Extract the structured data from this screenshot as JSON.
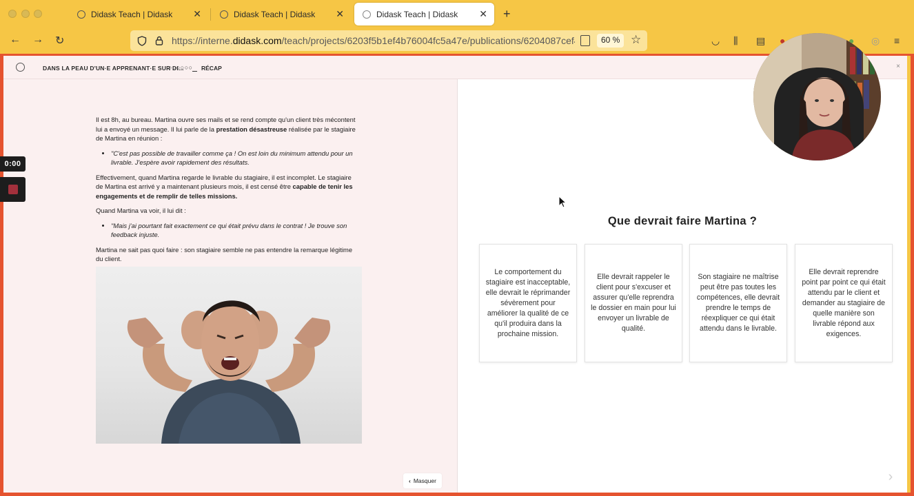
{
  "browser": {
    "tabs": [
      {
        "title": "Didask Teach | Didask",
        "close": "✕"
      },
      {
        "title": "Didask Teach | Didask",
        "close": "✕"
      },
      {
        "title": "Didask Teach | Didask",
        "close": "✕"
      }
    ],
    "new_tab": "+",
    "url_prefix": "https://interne.",
    "url_domain": "didask.com",
    "url_path": "/teach/projects/6203f5b1ef4b76004fc5a47e/publications/6204087cef4b76",
    "zoom": "60 %"
  },
  "course": {
    "breadcrumb": "DANS LA PEAU D'UN·E APPRENANT·E SUR DI...",
    "progress_dots": "○○○○○○",
    "recap": "RÉCAP",
    "close": "×"
  },
  "story": {
    "p1_before": "Il est 8h, au bureau. Martina ouvre ses mails et se rend compte qu'un client très mécontent lui a envoyé un message. Il lui parle de la ",
    "p1_bold": "prestation désastreuse",
    "p1_after": " réalisée par le stagiaire de Martina en réunion :",
    "quote1": "\"C'est pas possible de travailler comme ça ! On est loin du minimum attendu pour un livrable. J'espère avoir rapidement des résultats.",
    "p2_before": "Effectivement, quand Martina regarde le livrable du stagiaire, il est incomplet. Le stagiaire de Martina est arrivé y a maintenant plusieurs mois, il est censé être ",
    "p2_bold": "capable de tenir les engagements et de remplir de telles missions.",
    "p3": "Quand Martina va voir, il lui dit :",
    "quote2": "\"Mais j'ai pourtant fait exactement ce qui était prévu dans le contrat ! Je trouve son feedback injuste.",
    "p4": "Martina ne sait pas quoi faire : son stagiaire semble ne pas entendre la remarque légitime du client."
  },
  "masquer": "Masquer",
  "question": "Que devrait faire Martina ?",
  "choices": [
    "Le comportement du stagiaire est inacceptable, elle devrait le réprimander sévèrement pour améliorer la qualité de ce qu'il produira dans la prochaine mission.",
    "Elle devrait rappeler le client pour s'excuser et assurer qu'elle reprendra le dossier en main pour lui envoyer un livrable de qualité.",
    "Son stagiaire ne maîtrise peut être pas toutes les compétences, elle devrait prendre le temps de réexpliquer ce qui était attendu dans le livrable.",
    "Elle devrait reprendre point par point ce qui était attendu par le client et demander au stagiaire de quelle manière son livrable répond aux exigences."
  ],
  "recorder": {
    "timer": "0:00"
  },
  "colors": {
    "chrome": "#f6c645",
    "frame": "#e5532f",
    "left_bg": "#fbf0f0",
    "stop": "#a3303c"
  }
}
